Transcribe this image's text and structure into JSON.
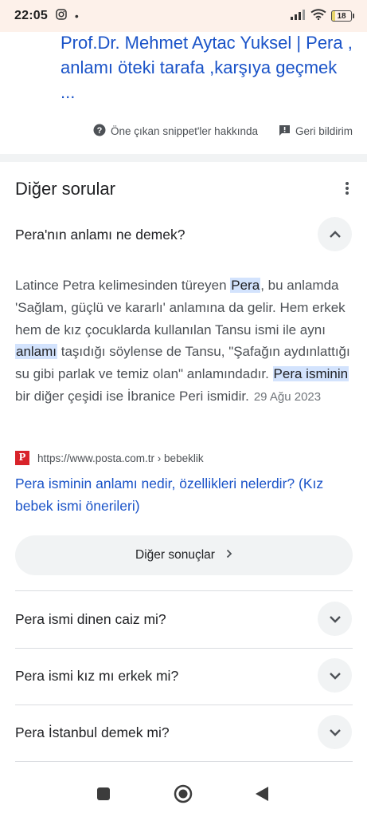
{
  "status_bar": {
    "time": "22:05",
    "dot": "•",
    "battery_level": "18",
    "battery_fraction": 0.18
  },
  "snippet": {
    "link_title": "Prof.Dr. Mehmet Aytac Yuksel | Pera , anlamı öteki tarafa ,karşıya geçmek ...",
    "about_label": "Öne çıkan snippet'ler hakkında",
    "feedback_label": "Geri bildirim"
  },
  "other_questions": {
    "title": "Diğer sorular",
    "expanded": {
      "question": "Pera'nın anlamı ne demek?",
      "answer_parts": {
        "p1": "Latince Petra kelimesinden türeyen ",
        "h1": "Pera",
        "p2": ", bu anlamda 'Sağlam, güçlü ve kararlı' anlamına da gelir. Hem erkek hem de kız çocuklarda kullanılan Tansu ismi ile aynı ",
        "h2": "anlamı",
        "p3": " taşıdığı söylense de Tansu, \"Şafağın aydınlattığı su gibi parlak ve temiz olan\" anlamındadır. ",
        "h3": "Pera isminin",
        "p4": " bir diğer çeşidi ise İbranice Peri ismidir."
      },
      "date": "29 Ağu 2023",
      "source_favicon": "P",
      "source_url": "https://www.posta.com.tr › bebeklik",
      "source_title": "Pera isminin anlamı nedir, özellikleri nelerdir? (Kız bebek ismi önerileri)",
      "more_results_label": "Diğer sonuçlar"
    },
    "collapsed": [
      {
        "question": "Pera ismi dinen caiz mi?"
      },
      {
        "question": "Pera ismi kız mı erkek mi?"
      },
      {
        "question": "Pera İstanbul demek mi?"
      }
    ]
  },
  "colors": {
    "link": "#1a53c8",
    "highlight": "#d3e3fd",
    "chip_bg": "#f1f3f4",
    "status_bg": "#fdf1ea"
  },
  "icons": [
    "instagram-icon",
    "signal-icon",
    "wifi-icon",
    "battery-icon",
    "help-icon",
    "feedback-icon",
    "more-vert-icon",
    "chevron-up-icon",
    "chevron-down-icon",
    "chevron-right-icon",
    "nav-square-icon",
    "nav-circle-icon",
    "nav-back-icon"
  ]
}
